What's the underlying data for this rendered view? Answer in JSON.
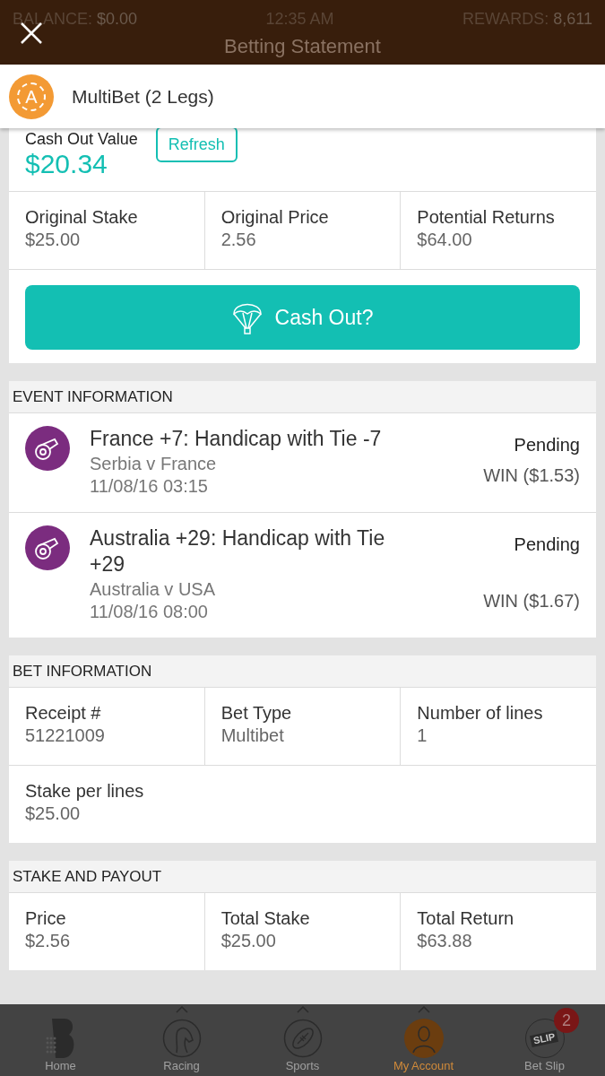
{
  "status_bar": {
    "balance_label": "BALANCE:",
    "balance": "$0.00",
    "time": "12:35 AM",
    "rewards_label": "REWARDS:",
    "rewards": "8,611"
  },
  "page_title": "Betting Statement",
  "header": {
    "logo_letter": "A",
    "title": "MultiBet (2 Legs)"
  },
  "cash_out": {
    "label": "Cash Out Value",
    "value": "$20.34",
    "refresh": "Refresh",
    "button": "Cash Out?",
    "stats": [
      {
        "label": "Original Stake",
        "value": "$25.00"
      },
      {
        "label": "Original Price",
        "value": "2.56"
      },
      {
        "label": "Potential Returns",
        "value": "$64.00"
      }
    ]
  },
  "sections": [
    {
      "title": "EVENT INFORMATION",
      "kind": "events",
      "events": [
        {
          "title": "France +7: Handicap with Tie -7",
          "match": "Serbia v France",
          "date": "11/08/16 03:15",
          "status": "Pending",
          "result": "WIN ($1.53)"
        },
        {
          "title": "Australia +29: Handicap with Tie +29",
          "match": "Australia v USA",
          "date": "11/08/16 08:00",
          "status": "Pending",
          "result": "WIN ($1.67)"
        }
      ]
    },
    {
      "title": "BET INFORMATION",
      "kind": "grid",
      "rows": [
        [
          {
            "label": "Receipt #",
            "value": "51221009"
          },
          {
            "label": "Bet Type",
            "value": "Multibet"
          },
          {
            "label": "Number of lines",
            "value": "1"
          }
        ],
        [
          {
            "label": "Stake per lines",
            "value": "$25.00"
          }
        ]
      ]
    },
    {
      "title": "STAKE AND PAYOUT",
      "kind": "grid",
      "rows": [
        [
          {
            "label": "Price",
            "value": "$2.56"
          },
          {
            "label": "Total Stake",
            "value": "$25.00"
          },
          {
            "label": "Total Return",
            "value": "$63.88"
          }
        ]
      ]
    }
  ],
  "nav": [
    {
      "kind": "home",
      "label": "Home",
      "selected": false,
      "caret": false
    },
    {
      "kind": "racing",
      "label": "Racing",
      "selected": false,
      "caret": true
    },
    {
      "kind": "sports",
      "label": "Sports",
      "selected": false,
      "caret": true
    },
    {
      "kind": "account",
      "label": "My Account",
      "selected": true,
      "caret": true
    },
    {
      "kind": "slip",
      "label": "Bet Slip",
      "selected": false,
      "caret": false,
      "icon_text": "SLIP",
      "badge": "2"
    }
  ]
}
